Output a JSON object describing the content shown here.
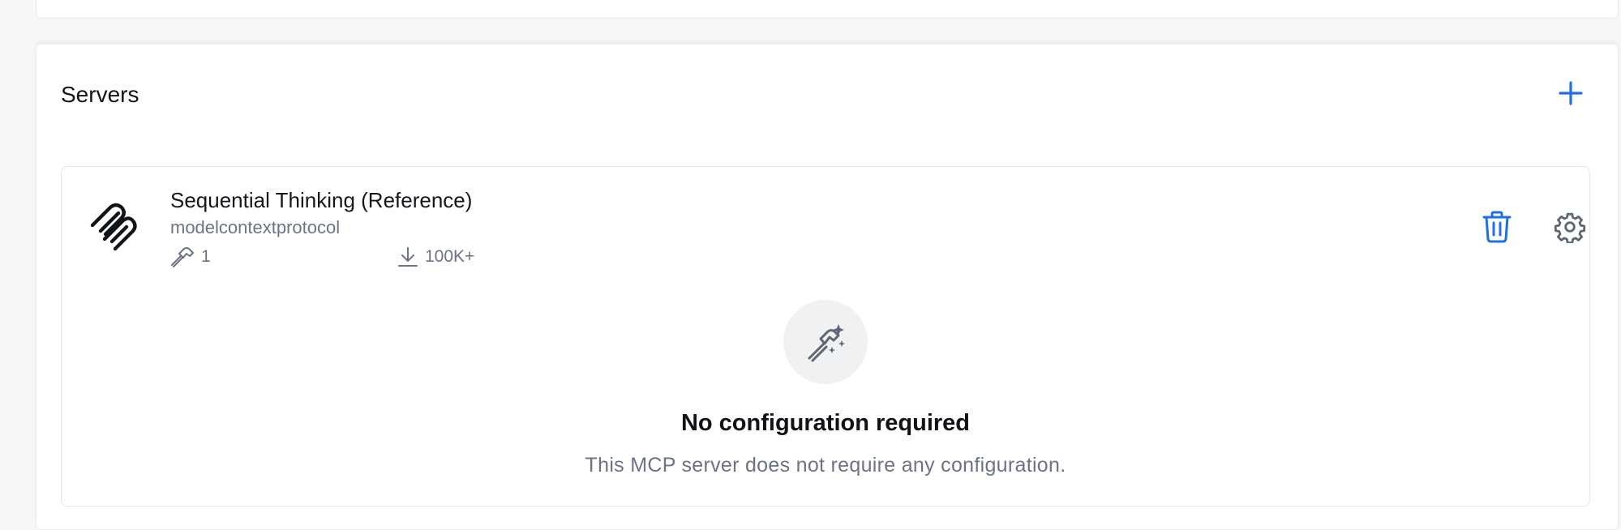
{
  "servers_section": {
    "title": "Servers",
    "add_icon": "plus-icon",
    "accent_color": "#1f6fe5"
  },
  "server": {
    "name": "Sequential Thinking (Reference)",
    "author": "modelcontextprotocol",
    "logo_icon": "mcp-logo-icon",
    "tools_icon": "hammer-icon",
    "tools_count": "1",
    "downloads_icon": "download-icon",
    "downloads": "100K+",
    "delete_icon": "trash-icon",
    "settings_icon": "gear-icon"
  },
  "empty_state": {
    "icon": "tools-sparkle-icon",
    "title": "No configuration required",
    "description": "This MCP server does not require any configuration."
  }
}
